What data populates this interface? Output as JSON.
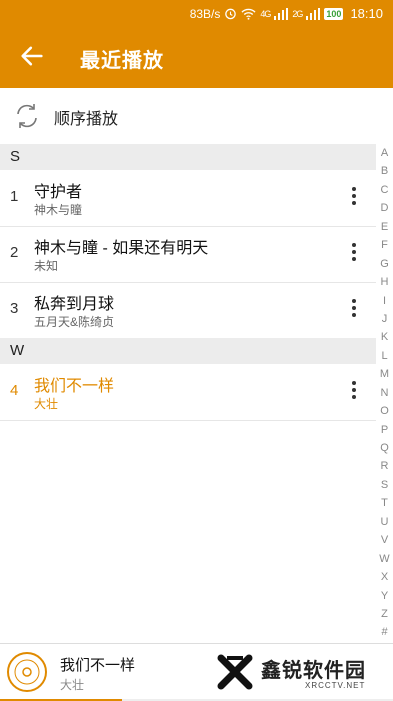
{
  "status_bar": {
    "net_speed": "83B/s",
    "signal_1": "4G",
    "signal_2": "2G",
    "battery": "100",
    "time": "18:10"
  },
  "header": {
    "title": "最近播放"
  },
  "play_mode": {
    "label": "顺序播放"
  },
  "sections": [
    {
      "letter": "S",
      "songs": [
        {
          "index": "1",
          "title": "守护者",
          "artist": "神木与瞳"
        },
        {
          "index": "2",
          "title": "神木与瞳 - 如果还有明天",
          "artist": "未知"
        },
        {
          "index": "3",
          "title": "私奔到月球",
          "artist": "五月天&陈绮贞"
        }
      ]
    },
    {
      "letter": "W",
      "songs": [
        {
          "index": "4",
          "title": "我们不一样",
          "artist": "大壮",
          "active": true
        }
      ]
    }
  ],
  "alphabet_index": [
    "A",
    "B",
    "C",
    "D",
    "E",
    "F",
    "G",
    "H",
    "I",
    "J",
    "K",
    "L",
    "M",
    "N",
    "O",
    "P",
    "Q",
    "R",
    "S",
    "T",
    "U",
    "V",
    "W",
    "X",
    "Y",
    "Z",
    "#"
  ],
  "now_playing": {
    "title": "我们不一样",
    "artist": "大壮",
    "progress": 0.31
  },
  "watermark": {
    "text": "鑫锐软件园",
    "sub": "XRCCTV.NET"
  },
  "colors": {
    "accent": "#E08A00",
    "section_bg": "#ECECEC"
  }
}
